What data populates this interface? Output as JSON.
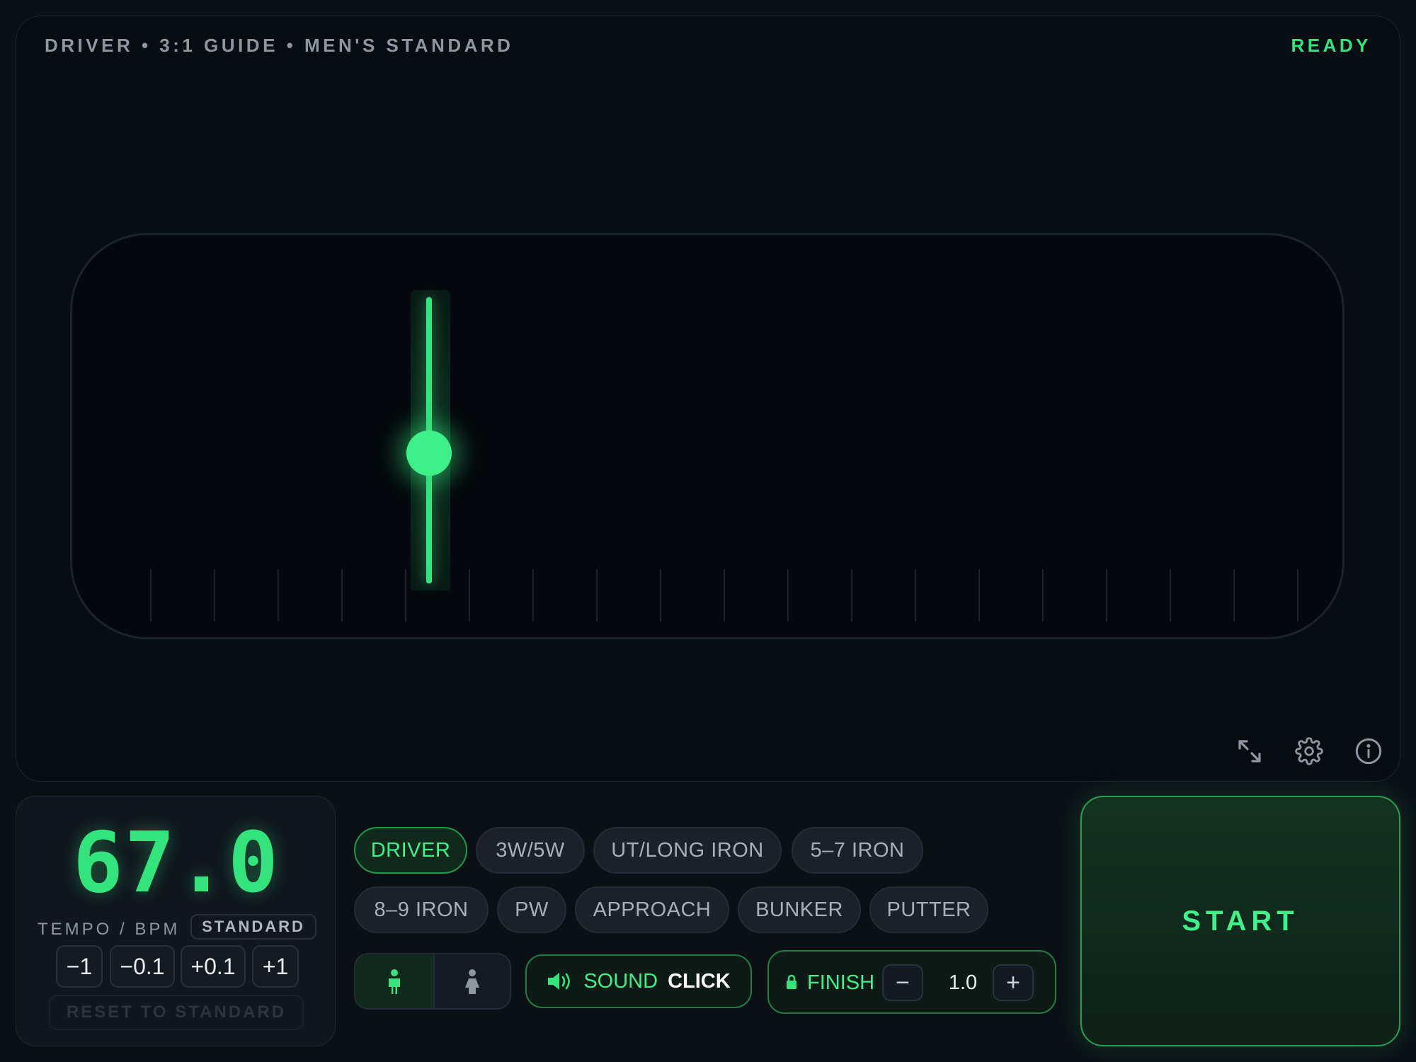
{
  "header": {
    "caption": "DRIVER • 3:1 GUIDE • MEN'S STANDARD",
    "status": "READY"
  },
  "visualizer": {
    "tick_count": 19,
    "pointer_tick_index": 4
  },
  "toolbar": {
    "icons": [
      "expand-icon",
      "gear-icon",
      "info-icon"
    ]
  },
  "tempo": {
    "value": "67.0",
    "label": "TEMPO / BPM",
    "badge": "STANDARD",
    "steps": [
      "−1",
      "−0.1",
      "+0.1",
      "+1"
    ],
    "reset": "RESET TO STANDARD"
  },
  "clubs": {
    "selected": "DRIVER",
    "row1": [
      "DRIVER",
      "3W/5W",
      "UT/LONG IRON",
      "5–7 IRON"
    ],
    "row2": [
      "8–9 IRON",
      "PW",
      "APPROACH",
      "BUNKER",
      "PUTTER"
    ]
  },
  "stance": {
    "options": [
      "male-figure-icon",
      "female-figure-icon"
    ],
    "selected": "male-figure-icon"
  },
  "sound": {
    "label": "SOUND",
    "value": "CLICK"
  },
  "finish": {
    "label": "FINISH",
    "minus": "−",
    "value": "1.0",
    "plus": "+"
  },
  "start": {
    "label": "START"
  },
  "colors": {
    "accent": "#33e37c",
    "background": "#0b1015",
    "panel": "#11171e"
  }
}
